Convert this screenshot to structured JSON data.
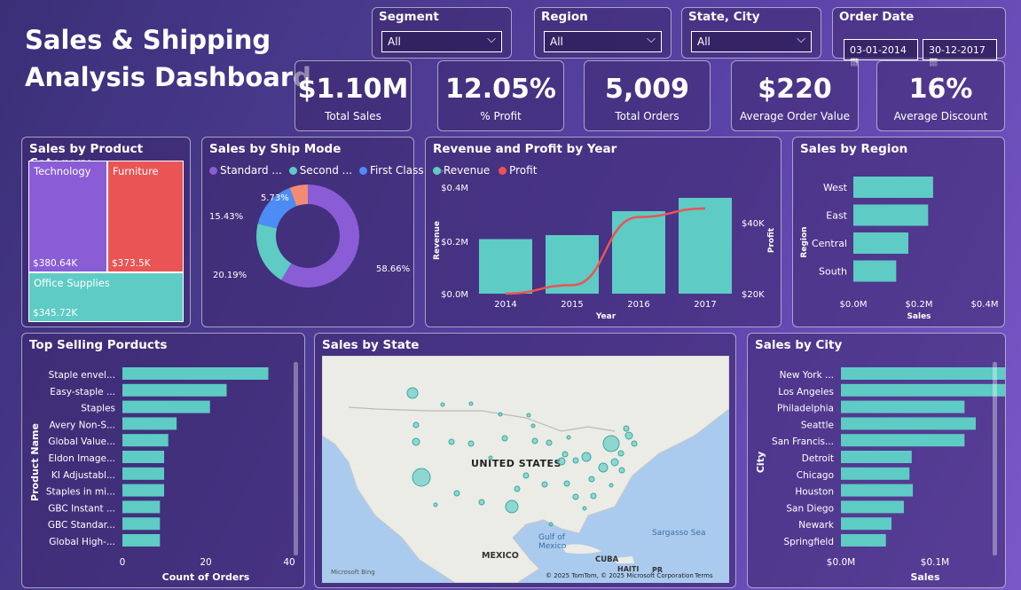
{
  "title": {
    "line1": "Sales & Shipping",
    "line2": "Analysis Dashboard"
  },
  "slicers": {
    "segment": {
      "label": "Segment",
      "value": "All"
    },
    "region": {
      "label": "Region",
      "value": "All"
    },
    "state_city": {
      "label": "State, City",
      "value": "All"
    },
    "order_date": {
      "label": "Order Date",
      "start": "03-01-2014",
      "end": "30-12-2017"
    }
  },
  "kpis": [
    {
      "value": "$1.10M",
      "label": "Total Sales"
    },
    {
      "value": "12.05%",
      "label": "% Profit"
    },
    {
      "value": "5,009",
      "label": "Total Orders"
    },
    {
      "value": "$220",
      "label": "Average Order Value"
    },
    {
      "value": "16%",
      "label": "Average Discount"
    }
  ],
  "colors": {
    "teal": "#5ecbc5",
    "purple": "#8a5cd6",
    "red": "#ea5454",
    "blue": "#4b8cf5",
    "salmon": "#f28b74"
  },
  "category": {
    "title": "Sales by Product Category",
    "items": [
      {
        "name": "Technology",
        "value": "$380.64K"
      },
      {
        "name": "Furniture",
        "value": "$373.5K"
      },
      {
        "name": "Office Supplies",
        "value": "$345.72K"
      }
    ]
  },
  "shipmode": {
    "title": "Sales by Ship Mode",
    "legend": [
      "Standard ...",
      "Second ...",
      "First Class"
    ],
    "labels": [
      "58.66%",
      "20.19%",
      "15.43%",
      "5.73%"
    ]
  },
  "revenue": {
    "title": "Revenue and Profit by Year",
    "legend": [
      "Revenue",
      "Profit"
    ],
    "ylabel": "Revenue",
    "y2label": "Profit",
    "xlabel": "Year",
    "yticks": [
      "$0.4M",
      "$0.2M",
      "$0.0M"
    ],
    "y2ticks": [
      "$40K",
      "$20K"
    ]
  },
  "region": {
    "title": "Sales by Region",
    "ylabel": "Region",
    "xlabel": "Sales",
    "xticks": [
      "$0.0M",
      "$0.2M",
      "$0.4M"
    ]
  },
  "products": {
    "title": "Top Selling Porducts",
    "ylabel": "Product Name",
    "xlabel": "Count of Orders",
    "xticks": [
      "0",
      "20",
      "40"
    ]
  },
  "state": {
    "title": "Sales by State",
    "country": "UNITED STATES",
    "gulf": "Gulf of\nMexico",
    "mexico": "MEXICO",
    "cuba": "CUBA",
    "haiti": "HAITI",
    "pr": "PR",
    "sargasso": "Sargasso Sea",
    "attribution": "© 2025 TomTom, © 2025 Microsoft Corporation",
    "terms": "Terms",
    "bing": "Microsoft Bing"
  },
  "city": {
    "title": "Sales by City",
    "ylabel": "City",
    "xlabel": "Sales",
    "xticks": [
      "$0.0M",
      "$0.1M"
    ]
  },
  "chart_data": [
    {
      "type": "bar",
      "title": "Revenue and Profit by Year",
      "categories": [
        "2014",
        "2015",
        "2016",
        "2017"
      ],
      "series": [
        {
          "name": "Revenue",
          "values": [
            0.205,
            0.22,
            0.31,
            0.36
          ]
        },
        {
          "name": "Profit",
          "values": [
            20000,
            22000,
            38000,
            40000
          ]
        }
      ],
      "xlabel": "Year",
      "ylabel": "Revenue",
      "ylim": [
        0,
        0.4
      ],
      "y2lim": [
        20000,
        45000
      ]
    },
    {
      "type": "bar",
      "title": "Sales by Region",
      "categories": [
        "West",
        "East",
        "Central",
        "South"
      ],
      "values": [
        0.725,
        0.68,
        0.5,
        0.39
      ],
      "xlabel": "Sales",
      "ylabel": "Region",
      "xlim": [
        0,
        0.4
      ]
    },
    {
      "type": "pie",
      "title": "Sales by Ship Mode",
      "categories": [
        "Standard Class",
        "Second Class",
        "First Class",
        "Same Day"
      ],
      "values": [
        58.66,
        20.19,
        15.43,
        5.73
      ]
    },
    {
      "type": "bar",
      "title": "Top Selling Porducts",
      "categories": [
        "Staple envel...",
        "Easy-staple ...",
        "Staples",
        "Avery Non-S...",
        "Global Value...",
        "Eldon Image...",
        "KI Adjustabl...",
        "Staples in mi...",
        "GBC Instant ...",
        "GBC Standar...",
        "Global High-..."
      ],
      "values": [
        35,
        25,
        21,
        13,
        11,
        10,
        10,
        10,
        9,
        9,
        9
      ],
      "xlabel": "Count of Orders",
      "ylabel": "Product Name",
      "xlim": [
        0,
        40
      ]
    },
    {
      "type": "bar",
      "title": "Sales by City",
      "categories": [
        "New York ...",
        "Los Angeles",
        "Philadelphia",
        "Seattle",
        "San Francis...",
        "Detroit",
        "Chicago",
        "Houston",
        "San Diego",
        "Newark",
        "Springfield"
      ],
      "values": [
        0.256,
        0.175,
        0.11,
        0.12,
        0.11,
        0.063,
        0.061,
        0.064,
        0.056,
        0.045,
        0.04
      ],
      "xlabel": "Sales",
      "ylabel": "City",
      "xlim": [
        0,
        0.15
      ]
    }
  ]
}
